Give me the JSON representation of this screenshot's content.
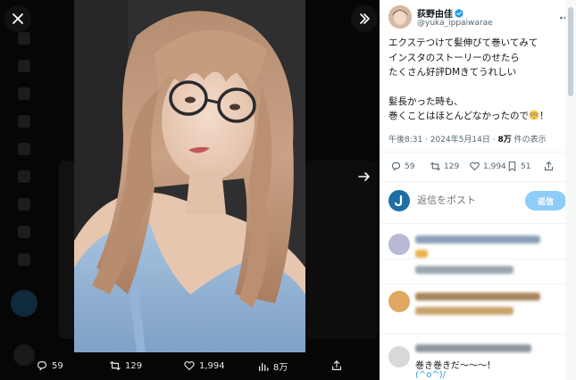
{
  "viewer": {
    "icons": {
      "close": "close-icon",
      "expand": "chevrons-right-icon",
      "next": "arrow-right-icon"
    },
    "actions": {
      "replies": "59",
      "reposts": "129",
      "likes": "1,994",
      "views": "8万"
    }
  },
  "author": {
    "name": "荻野由佳",
    "handle": "@yuka_ippaiwarae",
    "verified": true
  },
  "tweet": {
    "lines": [
      "エクステつけて髪伸びて巻いてみて",
      "インスタのストーリーのせたら",
      "たくさん好評DMきてうれしい",
      "髪長かった時も、",
      "巻くことはほとんどなかったので",
      "！"
    ],
    "meta": {
      "time": "午後8:31 · 2024年5月14日 · ",
      "views_count": "8万",
      "views_suffix": " 件の表示"
    }
  },
  "actions": {
    "replies": "59",
    "reposts": "129",
    "likes": "1,994",
    "bookmarks": "51"
  },
  "reply_box": {
    "placeholder": "返信をポスト",
    "button": "返信"
  },
  "replies": {
    "third_line1": "巻き巻きだ〜〜〜！",
    "third_line2": "(^o^)/"
  },
  "colors": {
    "accent": "#1d9bf0",
    "reply_button_disabled": "#8ecdf8",
    "secondary_text": "#536471"
  }
}
